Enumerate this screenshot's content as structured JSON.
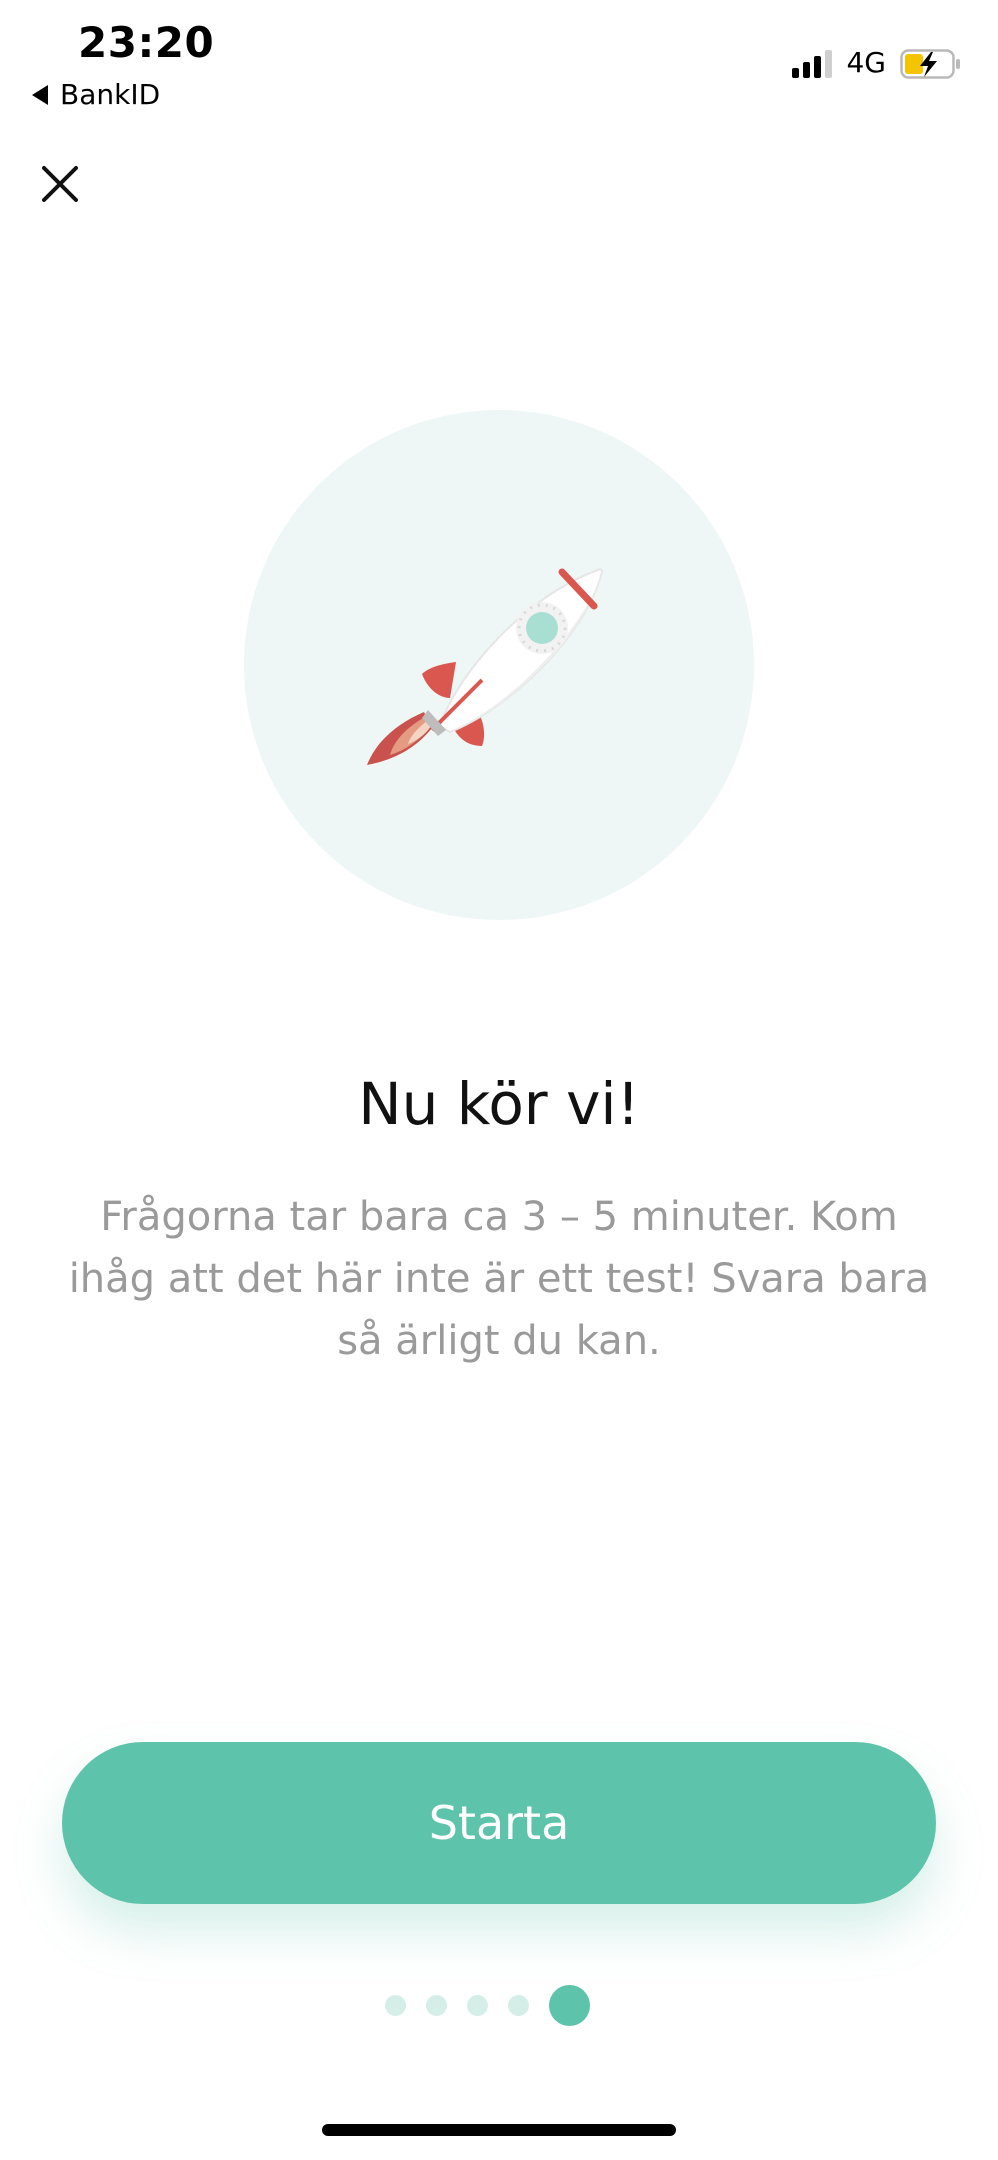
{
  "status_bar": {
    "time": "23:20",
    "back_app": "BankID",
    "network": "4G",
    "battery_color": "#f5c400"
  },
  "content": {
    "title": "Nu kör vi!",
    "description": "Frågorna tar bara ca 3 – 5 minuter. Kom ihåg att det här inte är ett test! Svara bara så ärligt du kan."
  },
  "actions": {
    "start_label": "Starta"
  },
  "pager": {
    "count": 5,
    "active_index": 4
  },
  "colors": {
    "accent": "#5ec3ab",
    "circle_bg": "#eef7f5",
    "body_text": "#9a9a9a"
  }
}
